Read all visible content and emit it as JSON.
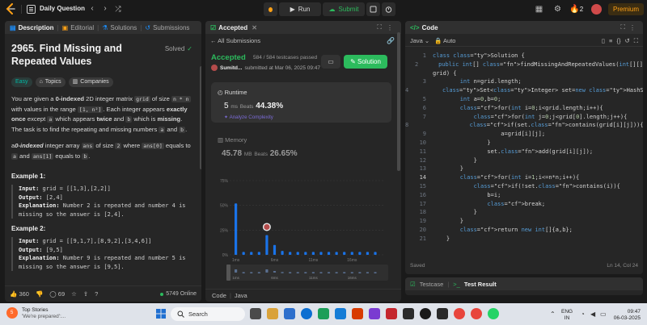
{
  "topbar": {
    "title": "Daily Question",
    "run_label": "Run",
    "submit_label": "Submit",
    "streak": "2",
    "premium_label": "Premium"
  },
  "left": {
    "tabs": [
      "Description",
      "Editorial",
      "Solutions",
      "Submissions"
    ],
    "title": "2965. Find Missing and Repeated Values",
    "solved_label": "Solved",
    "chips": [
      "Easy",
      "Topics",
      "Companies"
    ],
    "desc": {
      "p1_a": "You are given a ",
      "p1_b": "0-indexed",
      "p1_c": " 2D integer matrix ",
      "p1_grid": "grid",
      "p1_d": " of size ",
      "p1_nn": "n * n",
      "p1_e": " with values in the range ",
      "p1_range": "[1, n²]",
      "p1_f": ". Each integer appears ",
      "p1_g": "exactly once",
      "p1_h": " except ",
      "p1_a2": "a",
      "p1_i": " which appears ",
      "p1_j": "twice",
      "p1_k": " and ",
      "p1_b2": "b",
      "p1_l": " which is ",
      "p1_m": "missing",
      "p1_n": ". The task is to find the repeating and missing numbers ",
      "p1_a3": "a",
      "p1_o": " and ",
      "p1_b3": "b",
      "p1_p": ".",
      "p2_a": "a",
      "p2_b": "0-indexed",
      "p2_c": " integer array ",
      "p2_ans": "ans",
      "p2_d": " of size ",
      "p2_two": "2",
      "p2_e": " where ",
      "p2_ans0": "ans[0]",
      "p2_f": " equals to ",
      "p2_g": " and ",
      "p2_ans1": "ans[1]",
      "p2_h": " equals to ",
      "p2_b2": "b",
      "p2_i": "."
    },
    "examples": [
      {
        "title": "Example 1:",
        "input_label": "Input:",
        "input": "grid = [[1,3],[2,2]]",
        "output_label": "Output:",
        "output": "[2,4]",
        "expl_label": "Explanation:",
        "expl": "Number 2 is repeated and number 4 is missing so the answer is [2,4]."
      },
      {
        "title": "Example 2:",
        "input_label": "Input:",
        "input": "grid = [[9,1,7],[8,9,2],[3,4,6]]",
        "output_label": "Output:",
        "output": "[9,5]",
        "expl_label": "Explanation:",
        "expl": "Number 9 is repeated and number 5 is missing so the answer is [9,5]."
      }
    ],
    "footer": {
      "likes": "360",
      "comments": "69",
      "online": "5749 Online"
    }
  },
  "mid": {
    "tab": "Accepted",
    "back_label": "All Submissions",
    "status": "Accepted",
    "passed": "584 / 584 testcases passed",
    "user": "Sumitd...",
    "submitted": "submitted at Mar 06, 2025 09:47",
    "solution_label": "Solution",
    "runtime": {
      "label": "Runtime",
      "value": "5",
      "unit": "ms",
      "beats_label": "Beats",
      "beats": "44.38%",
      "analyze": "Analyze Complexity"
    },
    "memory": {
      "label": "Memory",
      "value": "45.78",
      "unit": "MB",
      "beats_label": "Beats",
      "beats": "26.65%"
    },
    "footer_code": "Code",
    "footer_lang": "Java"
  },
  "chart_data": {
    "type": "bar",
    "y_ticks": [
      "75%",
      "50%",
      "25%",
      "0%"
    ],
    "ylim": [
      0,
      75
    ],
    "x_ticks": [
      "1ms",
      "6ms",
      "11ms",
      "16ms"
    ],
    "mini_ticks": [
      "1ms",
      "6ms",
      "11ms",
      "16ms"
    ],
    "categories": [
      "1ms",
      "2ms",
      "3ms",
      "4ms",
      "5ms",
      "6ms",
      "7ms",
      "8ms",
      "9ms",
      "10ms",
      "11ms",
      "12ms",
      "13ms",
      "14ms",
      "15ms",
      "16ms",
      "17ms",
      "18ms",
      "19ms"
    ],
    "values": [
      52,
      3,
      3,
      3,
      20,
      10,
      4,
      3,
      3,
      3,
      3,
      3,
      3,
      3,
      3,
      3,
      3,
      3,
      3
    ],
    "highlight_index": 4,
    "bar_color": "#1a73e8"
  },
  "right": {
    "tab": "Code",
    "lang": "Java",
    "auto": "Auto",
    "lines": [
      "class Solution {",
      "    public int[] findMissingAndRepeatedValues(int[][]",
      "grid) {",
      "        int n=grid.length;",
      "        Set<Integer> set=new HashSet<>();",
      "        int a=0,b=0;",
      "        for(int i=0;i<grid.length;i++){",
      "            for(int j=0;j<grid[0].length;j++){",
      "                if(set.contains(grid[i][j])){",
      "                    a=grid[i][j];",
      "                }",
      "                set.add(grid[i][j]);",
      "            }",
      "        }",
      "        for(int i=1;i<=n*n;i++){",
      "            if(!set.contains(i)){",
      "                b=i;",
      "                break;",
      "            }",
      "        }",
      "        return new int[]{a,b};",
      "    }"
    ],
    "line_numbers": [
      "1",
      "",
      "",
      "2",
      "3",
      "4",
      "5",
      "6",
      "7",
      "8",
      "9",
      "10",
      "11",
      "12",
      "13",
      "14",
      "15",
      "16",
      "17",
      "18",
      "19",
      "20",
      "21",
      "22"
    ],
    "saved": "Saved",
    "cursor": "Ln 14, Col 24"
  },
  "bottom": {
    "testcase": "Testcase",
    "result": "Test Result"
  },
  "taskbar": {
    "news_title": "Top Stories",
    "news_sub": "'We're prepared':...",
    "news_badge": "5",
    "search": "Search",
    "lang1": "ENG",
    "lang2": "IN",
    "time": "09:47",
    "date": "06-03-2025"
  }
}
